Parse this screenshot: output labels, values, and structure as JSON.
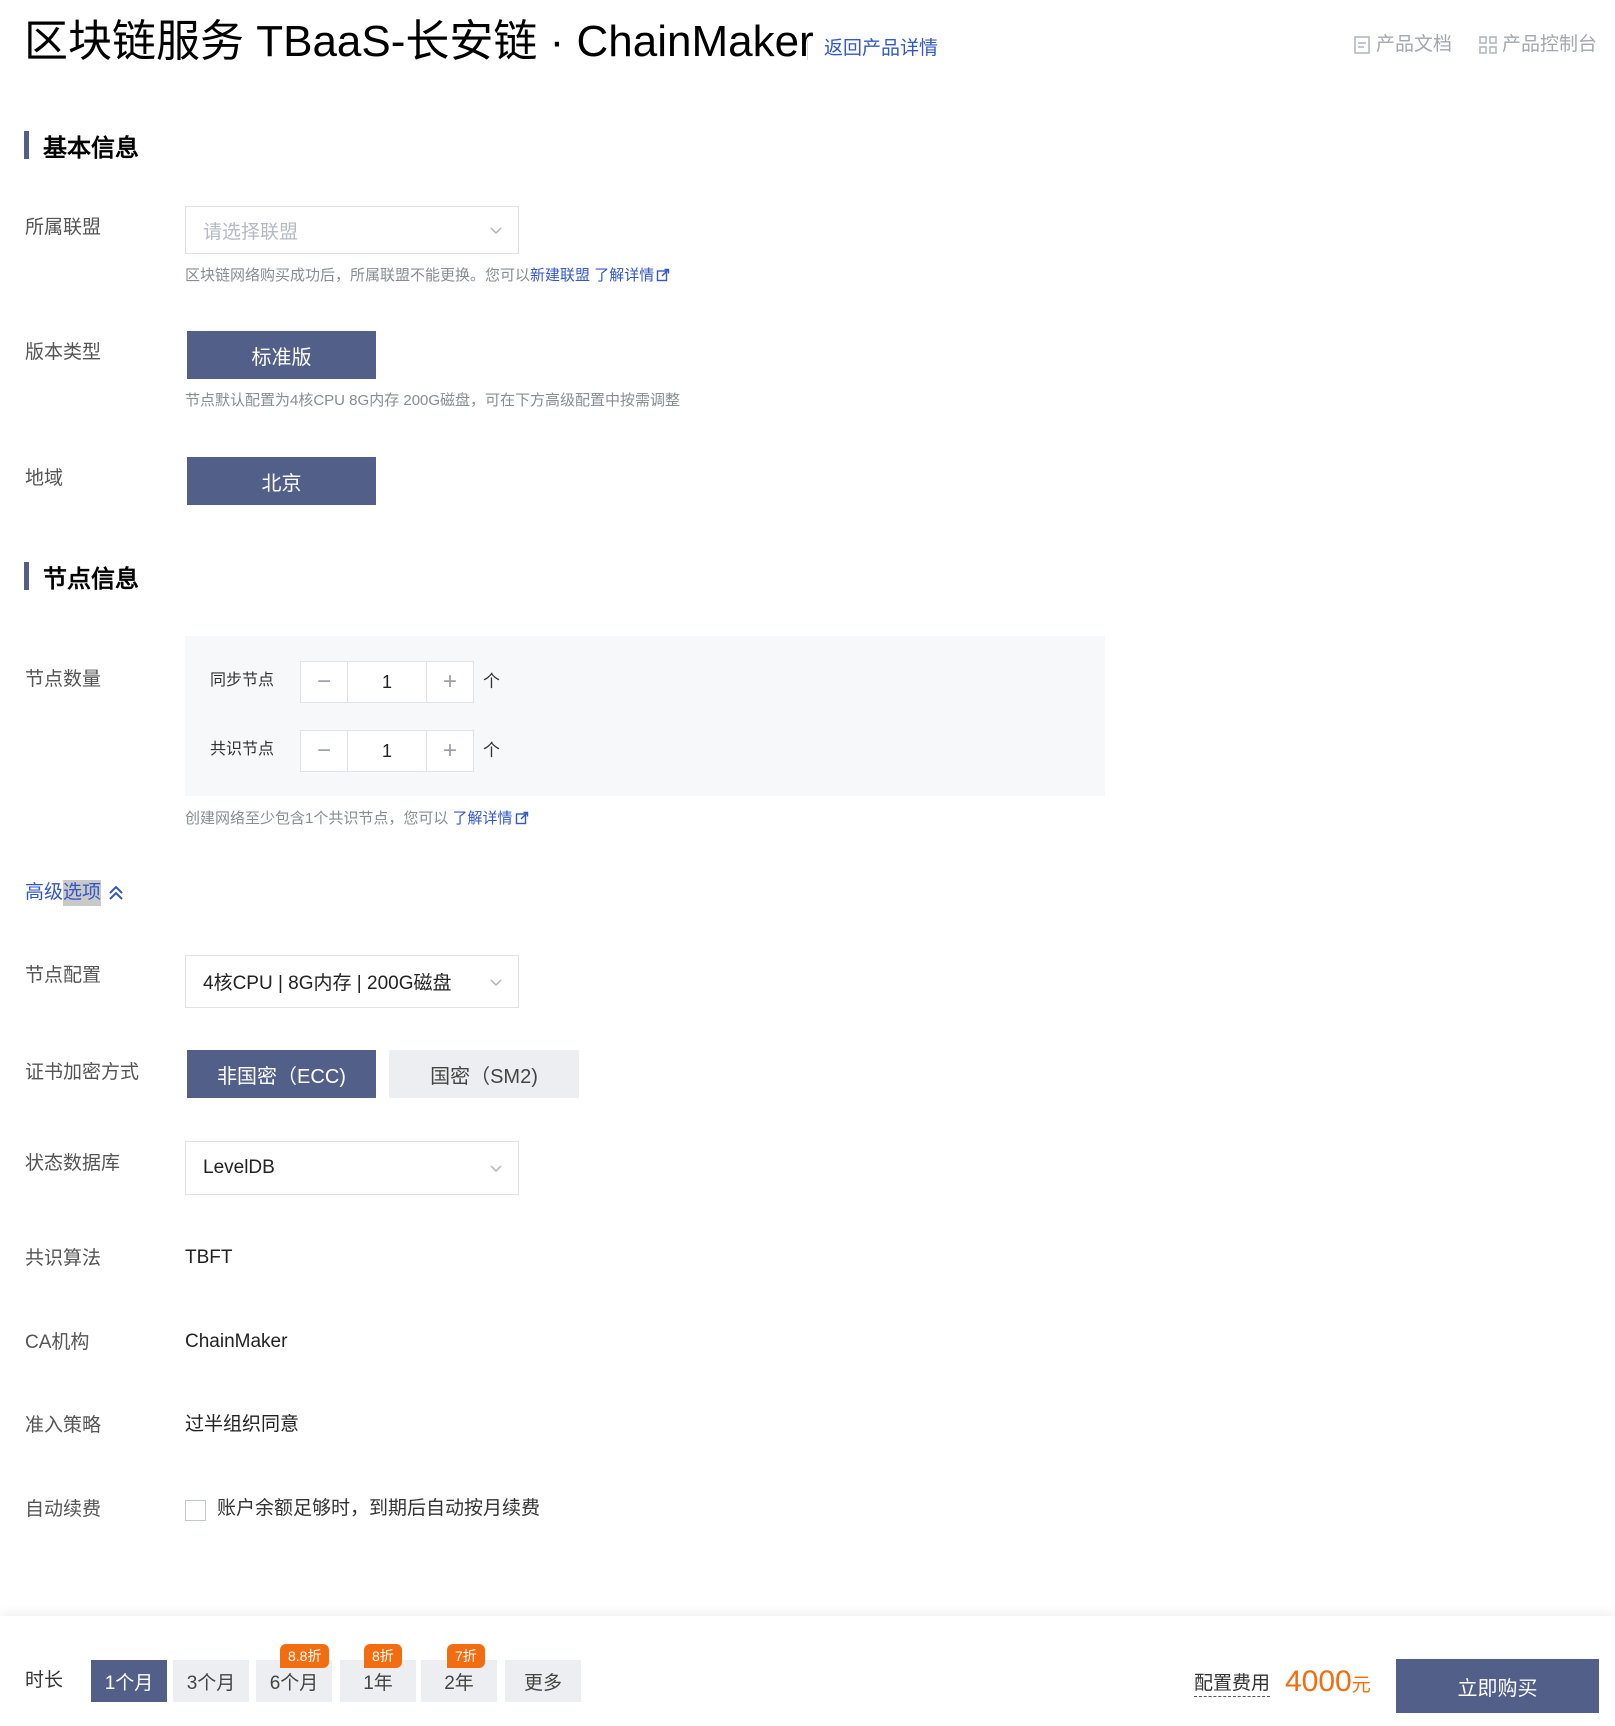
{
  "header": {
    "title": "区块链服务 TBaaS-长安链 · ChainMaker",
    "back_link": "返回产品详情",
    "docs_link": "产品文档",
    "console_link": "产品控制台"
  },
  "basic_section": {
    "title": "基本信息",
    "alliance": {
      "label": "所属联盟",
      "placeholder": "请选择联盟",
      "hint_prefix": "区块链网络购买成功后，所属联盟不能更换。您可以",
      "hint_link_new": "新建联盟",
      "hint_link_more": "了解详情"
    },
    "version": {
      "label": "版本类型",
      "selected": "标准版",
      "hint": "节点默认配置为4核CPU 8G内存 200G磁盘，可在下方高级配置中按需调整"
    },
    "region": {
      "label": "地域",
      "selected": "北京"
    }
  },
  "node_section": {
    "title": "节点信息",
    "count_label": "节点数量",
    "sync_node": {
      "label": "同步节点",
      "value": "1",
      "unit": "个"
    },
    "consensus_node": {
      "label": "共识节点",
      "value": "1",
      "unit": "个"
    },
    "stepper_minus": "−",
    "stepper_plus": "+",
    "hint_prefix": "创建网络至少包含1个共识节点，您可以",
    "hint_link": "了解详情"
  },
  "advanced": {
    "toggle_label_a": "高级",
    "toggle_label_b": "选项",
    "node_config": {
      "label": "节点配置",
      "value": "4核CPU | 8G内存 | 200G磁盘"
    },
    "cert_encryption": {
      "label": "证书加密方式",
      "options": [
        "非国密（ECC)",
        "国密（SM2)"
      ],
      "selected_index": 0
    },
    "state_db": {
      "label": "状态数据库",
      "value": "LevelDB"
    },
    "consensus_algo": {
      "label": "共识算法",
      "value": "TBFT"
    },
    "ca": {
      "label": "CA机构",
      "value": "ChainMaker"
    },
    "admission": {
      "label": "准入策略",
      "value": "过半组织同意"
    },
    "auto_renew": {
      "label": "自动续费",
      "checkbox_text": "账户余额足够时，到期后自动按月续费",
      "checked": false
    }
  },
  "bottom_bar": {
    "duration_label": "时长",
    "durations": [
      {
        "label": "1个月",
        "badge": ""
      },
      {
        "label": "3个月",
        "badge": ""
      },
      {
        "label": "6个月",
        "badge": "8.8折"
      },
      {
        "label": "1年",
        "badge": "8折"
      },
      {
        "label": "2年",
        "badge": "7折"
      },
      {
        "label": "更多",
        "badge": ""
      }
    ],
    "selected_duration_index": 0,
    "fee_label": "配置费用",
    "fee_amount": "4000",
    "fee_currency": "元",
    "buy_button": "立即购买"
  },
  "colors": {
    "primary": "#525f89",
    "link": "#3358c4",
    "discount": "#f26d10"
  }
}
